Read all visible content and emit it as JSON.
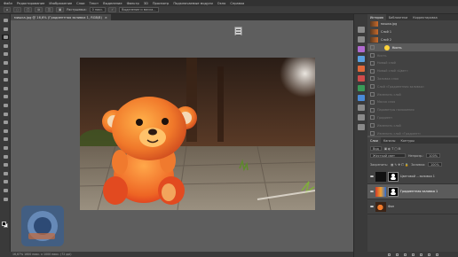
{
  "menu": [
    "Файл",
    "Редактирование",
    "Изображение",
    "Слои",
    "Текст",
    "Выделение",
    "Фильтр",
    "3D",
    "Просмотр",
    "Подключаемые модули",
    "Окно",
    "Справка"
  ],
  "options": {
    "tolerance_label": "Растушевка:",
    "tolerance_value": "0 пикс.",
    "select_mask_label": "Выделение и маска..."
  },
  "document_tab": {
    "title": "мишка.jpg @ 16,6% (Градиентная заливка 1, RGB/8)",
    "close": "×"
  },
  "history": {
    "tabs": [
      "История",
      "Библиотеки",
      "Корректировка"
    ],
    "items": [
      {
        "label": "мишка.jpg",
        "state": "done"
      },
      {
        "label": "Слой 1",
        "state": "done"
      },
      {
        "label": "Слой 2",
        "state": "done"
      },
      {
        "label": "Кисть",
        "state": "current"
      },
      {
        "label": "Кисть",
        "state": "undone"
      },
      {
        "label": "Новый слой",
        "state": "undone"
      },
      {
        "label": "Новый слой «Цвет»",
        "state": "undone"
      },
      {
        "label": "Заливка слоя",
        "state": "undone"
      },
      {
        "label": "Слой «Градиентная заливка»",
        "state": "undone"
      },
      {
        "label": "Изменить слой",
        "state": "undone"
      },
      {
        "label": "Маска слоя",
        "state": "undone"
      },
      {
        "label": "Параметры наложения",
        "state": "undone"
      },
      {
        "label": "Градиент",
        "state": "undone"
      },
      {
        "label": "Изменить слой",
        "state": "undone"
      },
      {
        "label": "Изменить слой «Градиент»",
        "state": "undone"
      }
    ]
  },
  "layers": {
    "tabs": [
      "Слои",
      "Каналы",
      "Контуры"
    ],
    "kind_label": "Вид",
    "blend_mode": "Жесткий свет",
    "opacity_label": "Непрозр.:",
    "opacity_value": "100%",
    "lock_label": "Закрепить:",
    "fill_label": "Заливка:",
    "fill_value": "100%",
    "rows": [
      {
        "name": "Цветовой ...заливка 1",
        "thumb": "#111111",
        "selected": false
      },
      {
        "name": "Градиентная заливка 1",
        "thumb": "gradient",
        "selected": true
      },
      {
        "name": "Фон",
        "thumb": "photo",
        "selected": false
      }
    ]
  },
  "status": "16,67%   1600 пикс. x 1000 пикс. (72 ppi)",
  "watermark_text": "Ps",
  "colors": {
    "accent": "#ffd43b",
    "panel": "#424242",
    "selected": "#5b5b5b"
  }
}
